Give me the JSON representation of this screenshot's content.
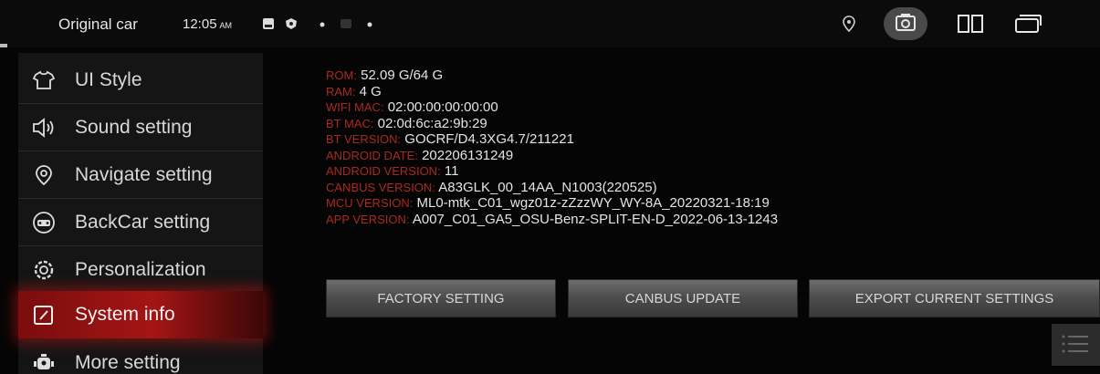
{
  "status_bar": {
    "title": "Original car",
    "time": "12:05",
    "ampm": "AM"
  },
  "sidebar": {
    "items": [
      {
        "label": "UI Style",
        "icon": "shirt-icon",
        "active": false
      },
      {
        "label": "Sound setting",
        "icon": "speaker-icon",
        "active": false
      },
      {
        "label": "Navigate setting",
        "icon": "location-pin-icon",
        "active": false
      },
      {
        "label": "BackCar setting",
        "icon": "car-icon",
        "active": false
      },
      {
        "label": "Personalization",
        "icon": "gear-icon",
        "active": false
      },
      {
        "label": "System info",
        "icon": "edit-icon",
        "active": true
      },
      {
        "label": "More setting",
        "icon": "robot-icon",
        "active": false
      }
    ]
  },
  "system_info": [
    {
      "key": "ROM:",
      "value": "52.09 G/64 G"
    },
    {
      "key": "RAM:",
      "value": "4 G"
    },
    {
      "key": "WIFI MAC:",
      "value": "02:00:00:00:00:00"
    },
    {
      "key": "BT MAC:",
      "value": "02:0d:6c:a2:9b:29"
    },
    {
      "key": "BT VERSION:",
      "value": "GOCRF/D4.3XG4.7/211221"
    },
    {
      "key": "ANDROID DATE:",
      "value": "202206131249"
    },
    {
      "key": "ANDROID VERSION:",
      "value": "11"
    },
    {
      "key": "CANBUS VERSION:",
      "value": "A83GLK_00_14AA_N1003(220525)"
    },
    {
      "key": "MCU VERSION:",
      "value": "ML0-mtk_C01_wgz01z-zZzzWY_WY-8A_20220321-18:19"
    },
    {
      "key": "APP VERSION:",
      "value": "A007_C01_GA5_OSU-Benz-SPLIT-EN-D_2022-06-13-1243"
    }
  ],
  "buttons": {
    "factory": "FACTORY SETTING",
    "canbus": "CANBUS UPDATE",
    "export": "EXPORT CURRENT SETTINGS"
  },
  "colors": {
    "accent_red": "#a51515",
    "info_key": "#a82a1e",
    "background": "#050505"
  }
}
